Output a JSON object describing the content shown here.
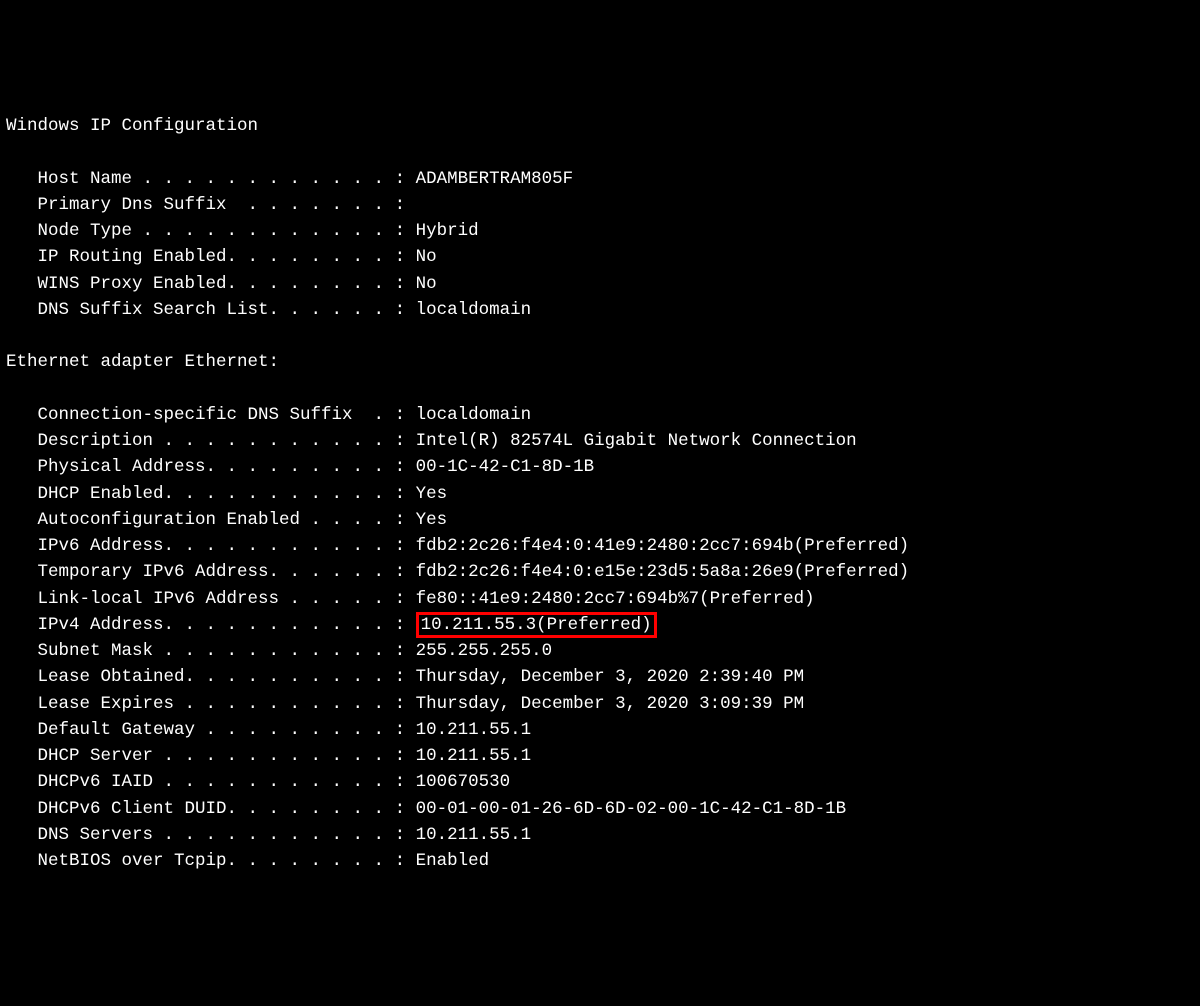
{
  "header": "Windows IP Configuration",
  "config": {
    "host_name_label": "   Host Name . . . . . . . . . . . . : ",
    "host_name": "ADAMBERTRAM805F",
    "primary_dns_suffix_label": "   Primary Dns Suffix  . . . . . . . :",
    "primary_dns_suffix": "",
    "node_type_label": "   Node Type . . . . . . . . . . . . : ",
    "node_type": "Hybrid",
    "ip_routing_label": "   IP Routing Enabled. . . . . . . . : ",
    "ip_routing": "No",
    "wins_proxy_label": "   WINS Proxy Enabled. . . . . . . . : ",
    "wins_proxy": "No",
    "dns_suffix_search_label": "   DNS Suffix Search List. . . . . . : ",
    "dns_suffix_search": "localdomain"
  },
  "adapter_header": "Ethernet adapter Ethernet:",
  "adapter": {
    "conn_dns_suffix_label": "   Connection-specific DNS Suffix  . : ",
    "conn_dns_suffix": "localdomain",
    "description_label": "   Description . . . . . . . . . . . : ",
    "description": "Intel(R) 82574L Gigabit Network Connection",
    "physical_address_label": "   Physical Address. . . . . . . . . : ",
    "physical_address": "00-1C-42-C1-8D-1B",
    "dhcp_enabled_label": "   DHCP Enabled. . . . . . . . . . . : ",
    "dhcp_enabled": "Yes",
    "autoconfig_label": "   Autoconfiguration Enabled . . . . : ",
    "autoconfig": "Yes",
    "ipv6_address_label": "   IPv6 Address. . . . . . . . . . . : ",
    "ipv6_address": "fdb2:2c26:f4e4:0:41e9:2480:2cc7:694b(Preferred)",
    "temp_ipv6_label": "   Temporary IPv6 Address. . . . . . : ",
    "temp_ipv6": "fdb2:2c26:f4e4:0:e15e:23d5:5a8a:26e9(Preferred)",
    "link_local_ipv6_label": "   Link-local IPv6 Address . . . . . : ",
    "link_local_ipv6": "fe80::41e9:2480:2cc7:694b%7(Preferred)",
    "ipv4_address_label": "   IPv4 Address. . . . . . . . . . . : ",
    "ipv4_address": "10.211.55.3(Preferred)",
    "subnet_mask_label": "   Subnet Mask . . . . . . . . . . . : ",
    "subnet_mask": "255.255.255.0",
    "lease_obtained_label": "   Lease Obtained. . . . . . . . . . : ",
    "lease_obtained": "Thursday, December 3, 2020 2:39:40 PM",
    "lease_expires_label": "   Lease Expires . . . . . . . . . . : ",
    "lease_expires": "Thursday, December 3, 2020 3:09:39 PM",
    "default_gateway_label": "   Default Gateway . . . . . . . . . : ",
    "default_gateway": "10.211.55.1",
    "dhcp_server_label": "   DHCP Server . . . . . . . . . . . : ",
    "dhcp_server": "10.211.55.1",
    "dhcpv6_iaid_label": "   DHCPv6 IAID . . . . . . . . . . . : ",
    "dhcpv6_iaid": "100670530",
    "dhcpv6_duid_label": "   DHCPv6 Client DUID. . . . . . . . : ",
    "dhcpv6_duid": "00-01-00-01-26-6D-6D-02-00-1C-42-C1-8D-1B",
    "dns_servers_label": "   DNS Servers . . . . . . . . . . . : ",
    "dns_servers": "10.211.55.1",
    "netbios_label": "   NetBIOS over Tcpip. . . . . . . . : ",
    "netbios": "Enabled"
  }
}
